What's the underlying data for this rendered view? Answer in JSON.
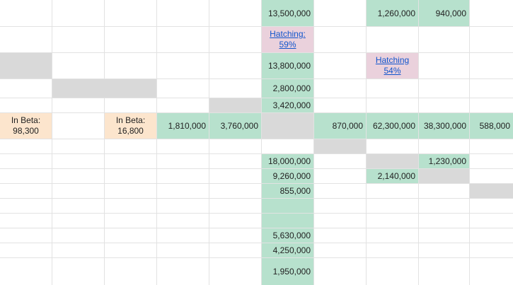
{
  "sheet": {
    "cells": [
      {
        "key": "r1_e",
        "value": "13,500,000"
      },
      {
        "key": "r1_g",
        "value": "1,260,000"
      },
      {
        "key": "r1_h",
        "value": "940,000"
      },
      {
        "key": "r2_e_label",
        "value": "Hatching:"
      },
      {
        "key": "r2_e_pct",
        "value": "59%"
      },
      {
        "key": "r3_e",
        "value": "13,800,000"
      },
      {
        "key": "r3_g_label",
        "value": "Hatching"
      },
      {
        "key": "r3_g_pct",
        "value": "54%"
      },
      {
        "key": "r4_e",
        "value": "2,800,000"
      },
      {
        "key": "r5_e",
        "value": "3,420,000"
      },
      {
        "key": "r6_a_label",
        "value": "In Beta:"
      },
      {
        "key": "r6_a_value",
        "value": "98,300"
      },
      {
        "key": "r6_c_label",
        "value": "In Beta:"
      },
      {
        "key": "r6_c_value",
        "value": "16,800"
      },
      {
        "key": "r6_d",
        "value": "1,810,000"
      },
      {
        "key": "r6_d2",
        "value": "3,760,000"
      },
      {
        "key": "r6_f",
        "value": "870,000"
      },
      {
        "key": "r6_g",
        "value": "62,300,000"
      },
      {
        "key": "r6_h",
        "value": "38,300,000"
      },
      {
        "key": "r6_i",
        "value": "588,000"
      },
      {
        "key": "r8_e",
        "value": "18,000,000"
      },
      {
        "key": "r8_h",
        "value": "1,230,000"
      },
      {
        "key": "r9_e",
        "value": "9,260,000"
      },
      {
        "key": "r9_g",
        "value": "2,140,000"
      },
      {
        "key": "r10_e",
        "value": "855,000"
      },
      {
        "key": "r13_e",
        "value": "5,630,000"
      },
      {
        "key": "r14_e",
        "value": "4,250,000"
      },
      {
        "key": "r15_e",
        "value": "1,950,000"
      }
    ],
    "colors": {
      "green": "#b7e1cd",
      "peach": "#fce5cd",
      "pink": "#ead1dc",
      "gray": "#d9d9d9",
      "link": "#1155cc",
      "gridline": "#e2e2e2"
    }
  }
}
